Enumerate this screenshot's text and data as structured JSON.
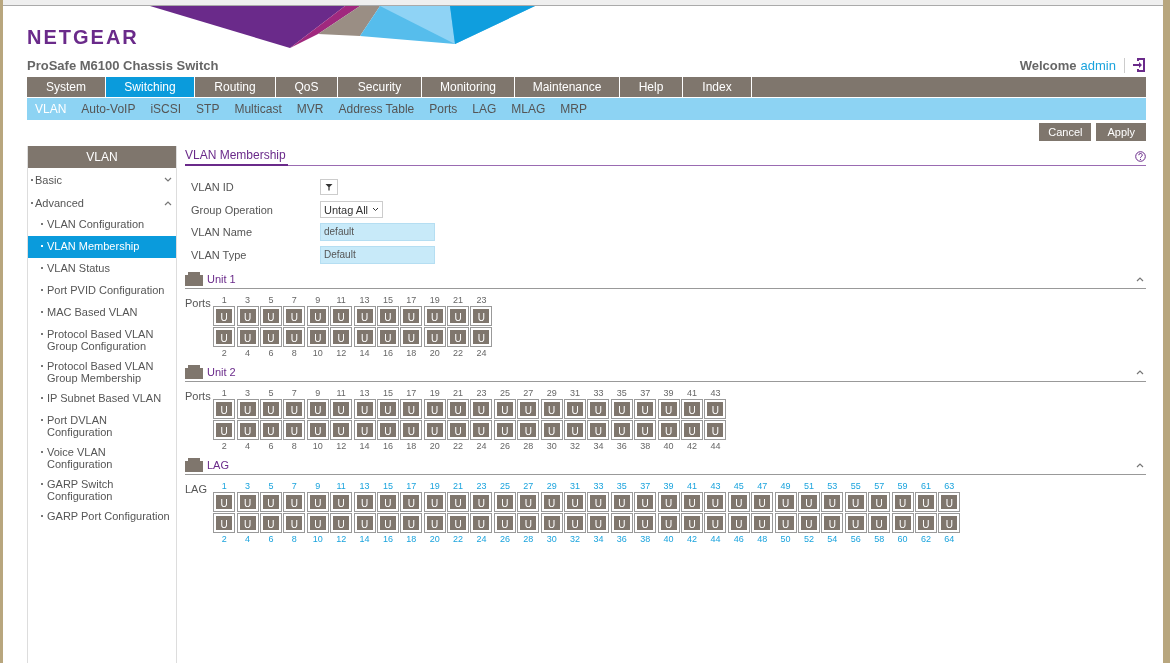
{
  "header": {
    "logo": "NETGEAR",
    "title": "ProSafe M6100 Chassis Switch",
    "welcome": "Welcome",
    "user": "admin"
  },
  "nav": [
    {
      "label": "System",
      "selected": false
    },
    {
      "label": "Switching",
      "selected": true
    },
    {
      "label": "Routing",
      "selected": false
    },
    {
      "label": "QoS",
      "selected": false
    },
    {
      "label": "Security",
      "selected": false
    },
    {
      "label": "Monitoring",
      "selected": false
    },
    {
      "label": "Maintenance",
      "selected": false
    },
    {
      "label": "Help",
      "selected": false
    },
    {
      "label": "Index",
      "selected": false
    }
  ],
  "subnav": [
    {
      "label": "VLAN",
      "selected": true
    },
    {
      "label": "Auto-VoIP",
      "selected": false
    },
    {
      "label": "iSCSI",
      "selected": false
    },
    {
      "label": "STP",
      "selected": false
    },
    {
      "label": "Multicast",
      "selected": false
    },
    {
      "label": "MVR",
      "selected": false
    },
    {
      "label": "Address Table",
      "selected": false
    },
    {
      "label": "Ports",
      "selected": false
    },
    {
      "label": "LAG",
      "selected": false
    },
    {
      "label": "MLAG",
      "selected": false
    },
    {
      "label": "MRP",
      "selected": false
    }
  ],
  "actions": [
    "Cancel",
    "Apply"
  ],
  "sidebar": {
    "title": "VLAN",
    "items": [
      {
        "label": "Basic",
        "expanded": false
      },
      {
        "label": "Advanced",
        "expanded": true,
        "children": [
          {
            "label": "VLAN Configuration",
            "selected": false
          },
          {
            "label": "VLAN Membership",
            "selected": true
          },
          {
            "label": "VLAN Status",
            "selected": false
          },
          {
            "label": "Port PVID Configuration",
            "selected": false
          },
          {
            "label": "MAC Based VLAN",
            "selected": false
          },
          {
            "label": "Protocol Based VLAN Group Configuration",
            "selected": false
          },
          {
            "label": "Protocol Based VLAN Group Membership",
            "selected": false
          },
          {
            "label": "IP Subnet Based VLAN",
            "selected": false
          },
          {
            "label": "Port DVLAN Configuration",
            "selected": false
          },
          {
            "label": "Voice VLAN Configuration",
            "selected": false
          },
          {
            "label": "GARP Switch Configuration",
            "selected": false
          },
          {
            "label": "GARP Port Configuration",
            "selected": false
          }
        ]
      }
    ]
  },
  "panel": {
    "title": "VLAN Membership",
    "fields": [
      {
        "label": "VLAN ID",
        "kind": "filter"
      },
      {
        "label": "Group Operation",
        "kind": "select",
        "value": "Untag All"
      },
      {
        "label": "VLAN Name",
        "kind": "text",
        "value": "default"
      },
      {
        "label": "VLAN Type",
        "kind": "text",
        "value": "Default"
      }
    ],
    "sections": [
      {
        "title": "Unit 1",
        "kind": "unit",
        "row_label": "Ports",
        "ports": [
          {
            "number": "1",
            "mode": "U"
          },
          {
            "number": "2",
            "mode": "U"
          },
          {
            "number": "3",
            "mode": "U"
          },
          {
            "number": "4",
            "mode": "U"
          },
          {
            "number": "5",
            "mode": "U"
          },
          {
            "number": "6",
            "mode": "U"
          },
          {
            "number": "7",
            "mode": "U"
          },
          {
            "number": "8",
            "mode": "U"
          },
          {
            "number": "9",
            "mode": "U"
          },
          {
            "number": "10",
            "mode": "U"
          },
          {
            "number": "11",
            "mode": "U"
          },
          {
            "number": "12",
            "mode": "U"
          },
          {
            "number": "13",
            "mode": "U"
          },
          {
            "number": "14",
            "mode": "U"
          },
          {
            "number": "15",
            "mode": "U"
          },
          {
            "number": "16",
            "mode": "U"
          },
          {
            "number": "17",
            "mode": "U"
          },
          {
            "number": "18",
            "mode": "U"
          },
          {
            "number": "19",
            "mode": "U"
          },
          {
            "number": "20",
            "mode": "U"
          },
          {
            "number": "21",
            "mode": "U"
          },
          {
            "number": "22",
            "mode": "U"
          },
          {
            "number": "23",
            "mode": "U"
          },
          {
            "number": "24",
            "mode": "U"
          }
        ]
      },
      {
        "title": "Unit 2",
        "kind": "unit",
        "row_label": "Ports",
        "ports": [
          {
            "number": "1",
            "mode": "U"
          },
          {
            "number": "2",
            "mode": "U"
          },
          {
            "number": "3",
            "mode": "U"
          },
          {
            "number": "4",
            "mode": "U"
          },
          {
            "number": "5",
            "mode": "U"
          },
          {
            "number": "6",
            "mode": "U"
          },
          {
            "number": "7",
            "mode": "U"
          },
          {
            "number": "8",
            "mode": "U"
          },
          {
            "number": "9",
            "mode": "U"
          },
          {
            "number": "10",
            "mode": "U"
          },
          {
            "number": "11",
            "mode": "U"
          },
          {
            "number": "12",
            "mode": "U"
          },
          {
            "number": "13",
            "mode": "U"
          },
          {
            "number": "14",
            "mode": "U"
          },
          {
            "number": "15",
            "mode": "U"
          },
          {
            "number": "16",
            "mode": "U"
          },
          {
            "number": "17",
            "mode": "U"
          },
          {
            "number": "18",
            "mode": "U"
          },
          {
            "number": "19",
            "mode": "U"
          },
          {
            "number": "20",
            "mode": "U"
          },
          {
            "number": "21",
            "mode": "U"
          },
          {
            "number": "22",
            "mode": "U"
          },
          {
            "number": "23",
            "mode": "U"
          },
          {
            "number": "24",
            "mode": "U"
          },
          {
            "number": "25",
            "mode": "U"
          },
          {
            "number": "26",
            "mode": "U"
          },
          {
            "number": "27",
            "mode": "U"
          },
          {
            "number": "28",
            "mode": "U"
          },
          {
            "number": "29",
            "mode": "U"
          },
          {
            "number": "30",
            "mode": "U"
          },
          {
            "number": "31",
            "mode": "U"
          },
          {
            "number": "32",
            "mode": "U"
          },
          {
            "number": "33",
            "mode": "U"
          },
          {
            "number": "34",
            "mode": "U"
          },
          {
            "number": "35",
            "mode": "U"
          },
          {
            "number": "36",
            "mode": "U"
          },
          {
            "number": "37",
            "mode": "U"
          },
          {
            "number": "38",
            "mode": "U"
          },
          {
            "number": "39",
            "mode": "U"
          },
          {
            "number": "40",
            "mode": "U"
          },
          {
            "number": "41",
            "mode": "U"
          },
          {
            "number": "42",
            "mode": "U"
          },
          {
            "number": "43",
            "mode": "U"
          },
          {
            "number": "44",
            "mode": "U"
          }
        ]
      },
      {
        "title": "LAG",
        "kind": "lag",
        "row_label": "LAG",
        "ports": [
          {
            "number": "1",
            "mode": "U"
          },
          {
            "number": "2",
            "mode": "U"
          },
          {
            "number": "3",
            "mode": "U"
          },
          {
            "number": "4",
            "mode": "U"
          },
          {
            "number": "5",
            "mode": "U"
          },
          {
            "number": "6",
            "mode": "U"
          },
          {
            "number": "7",
            "mode": "U"
          },
          {
            "number": "8",
            "mode": "U"
          },
          {
            "number": "9",
            "mode": "U"
          },
          {
            "number": "10",
            "mode": "U"
          },
          {
            "number": "11",
            "mode": "U"
          },
          {
            "number": "12",
            "mode": "U"
          },
          {
            "number": "13",
            "mode": "U"
          },
          {
            "number": "14",
            "mode": "U"
          },
          {
            "number": "15",
            "mode": "U"
          },
          {
            "number": "16",
            "mode": "U"
          },
          {
            "number": "17",
            "mode": "U"
          },
          {
            "number": "18",
            "mode": "U"
          },
          {
            "number": "19",
            "mode": "U"
          },
          {
            "number": "20",
            "mode": "U"
          },
          {
            "number": "21",
            "mode": "U"
          },
          {
            "number": "22",
            "mode": "U"
          },
          {
            "number": "23",
            "mode": "U"
          },
          {
            "number": "24",
            "mode": "U"
          },
          {
            "number": "25",
            "mode": "U"
          },
          {
            "number": "26",
            "mode": "U"
          },
          {
            "number": "27",
            "mode": "U"
          },
          {
            "number": "28",
            "mode": "U"
          },
          {
            "number": "29",
            "mode": "U"
          },
          {
            "number": "30",
            "mode": "U"
          },
          {
            "number": "31",
            "mode": "U"
          },
          {
            "number": "32",
            "mode": "U"
          },
          {
            "number": "33",
            "mode": "U"
          },
          {
            "number": "34",
            "mode": "U"
          },
          {
            "number": "35",
            "mode": "U"
          },
          {
            "number": "36",
            "mode": "U"
          },
          {
            "number": "37",
            "mode": "U"
          },
          {
            "number": "38",
            "mode": "U"
          },
          {
            "number": "39",
            "mode": "U"
          },
          {
            "number": "40",
            "mode": "U"
          },
          {
            "number": "41",
            "mode": "U"
          },
          {
            "number": "42",
            "mode": "U"
          },
          {
            "number": "43",
            "mode": "U"
          },
          {
            "number": "44",
            "mode": "U"
          },
          {
            "number": "45",
            "mode": "U"
          },
          {
            "number": "46",
            "mode": "U"
          },
          {
            "number": "47",
            "mode": "U"
          },
          {
            "number": "48",
            "mode": "U"
          },
          {
            "number": "49",
            "mode": "U"
          },
          {
            "number": "50",
            "mode": "U"
          },
          {
            "number": "51",
            "mode": "U"
          },
          {
            "number": "52",
            "mode": "U"
          },
          {
            "number": "53",
            "mode": "U"
          },
          {
            "number": "54",
            "mode": "U"
          },
          {
            "number": "55",
            "mode": "U"
          },
          {
            "number": "56",
            "mode": "U"
          },
          {
            "number": "57",
            "mode": "U"
          },
          {
            "number": "58",
            "mode": "U"
          },
          {
            "number": "59",
            "mode": "U"
          },
          {
            "number": "60",
            "mode": "U"
          },
          {
            "number": "61",
            "mode": "U"
          },
          {
            "number": "62",
            "mode": "U"
          },
          {
            "number": "63",
            "mode": "U"
          },
          {
            "number": "64",
            "mode": "U"
          }
        ]
      }
    ]
  }
}
